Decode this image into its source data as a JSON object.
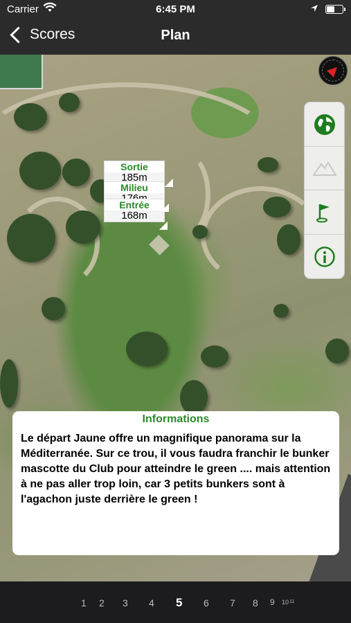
{
  "status": {
    "carrier": "Carrier",
    "time": "6:45 PM"
  },
  "nav": {
    "back_label": "Scores",
    "title": "Plan"
  },
  "distances": [
    {
      "label": "Sortie",
      "value": "185m"
    },
    {
      "label": "Milieu",
      "value": "176m"
    },
    {
      "label": "Entrée",
      "value": "168m"
    }
  ],
  "tools": [
    {
      "icon": "globe-icon"
    },
    {
      "icon": "terrain-icon"
    },
    {
      "icon": "flag-icon"
    },
    {
      "icon": "info-icon"
    }
  ],
  "info": {
    "title": "Informations",
    "text": "Le départ Jaune offre un magnifique panorama sur la Méditerranée. Sur ce trou, il vous faudra franchir le bunker mascotte du Club pour atteindre le green .... mais attention à ne pas aller trop loin, car 3 petits bunkers sont à l'agachon juste derrière le green !"
  },
  "pager": {
    "pages": [
      "1",
      "2",
      "3",
      "4",
      "5",
      "6",
      "7",
      "8",
      "9",
      "10",
      "11"
    ],
    "current": "5"
  },
  "colors": {
    "accent_green": "#2a8a2a",
    "bar_bg": "#2b2b2b"
  }
}
